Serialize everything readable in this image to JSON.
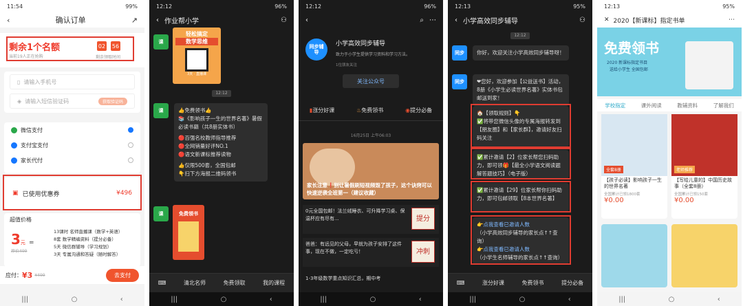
{
  "colors": {
    "accent": "#ef3b2c",
    "orange": "#f0542d",
    "green": "#2aa84a",
    "dark_bg": "#1b1b1b",
    "bubble": "#2e2e2e"
  },
  "p1": {
    "time": "11:54",
    "battery": "99%",
    "title": "确认订单",
    "remaining": "剩余1个名额",
    "remaining_sub": "当前19人正在抢购",
    "cd1": "02",
    "cd2": "56",
    "cd_sub": "剩余领取时间",
    "phone_placeholder": "请输入手机号",
    "code_placeholder": "请输入短信验证码",
    "get_code": "获取验证码",
    "payments": [
      {
        "label": "微信支付",
        "color": "#2aa84a"
      },
      {
        "label": "支付宝支付",
        "color": "#1677ff"
      },
      {
        "label": "家长代付",
        "color": "#1677ff"
      }
    ],
    "coupon_label": "已使用优惠券",
    "coupon_amount": "¥496",
    "value_title": "超值价格",
    "price_big": "3",
    "price_unit": "元",
    "price_eq": "=",
    "price_old": "原价499",
    "items": [
      "13课时 名师直播课（数学+英语）",
      "8套 数学精编资料（提分必备）",
      "5天 微信群辅导（学习规划）",
      "3天 专属沟通和答疑（随时解答）"
    ],
    "pay_label": "应付：",
    "pay_amount": "¥3",
    "pay_old": "¥499",
    "pay_button": "去支付"
  },
  "p2": {
    "time": "12:12",
    "battery": "96%",
    "title": "作业帮小学",
    "poster_title1": "轻松搞定",
    "poster_title2": "数学思维",
    "poster_sub": "3天 · 直播课",
    "timestamp": "12:12",
    "messages": [
      "👍免费领书👍",
      "📚《影响孩子一生的世界名著》暑假必读书籍（共8册实体书）",
      "🔴百强名校教师指导推荐",
      "🔴全网销量好评NO.1",
      "🔴语文新课标推荐读物",
      "👍仅限500套，全国包邮",
      "👇扫下方海报二维码领书"
    ],
    "poster2_title": "免费领书",
    "menu": [
      "清北名师",
      "免费领取",
      "我的课程"
    ],
    "avatar": "课"
  },
  "p3": {
    "time": "12:12",
    "battery": "96%",
    "name": "小学高效同步辅导",
    "logo_text": "同步辅导",
    "desc": "致力于小学生提供学习资料和学习方法。",
    "followers": "1位朋友关注",
    "follow_button": "关注公众号",
    "tabs": [
      "涨分好课",
      "免费领书",
      "提分必备"
    ],
    "date": "16月25日 上午06:03",
    "headline": "家长注意❗别让暑假刷短视频毁了孩子，这个诀窍可以快速逆袭全班第一（建议收藏）",
    "articles": [
      {
        "text": "0元全国包邮！法兰绒睡衣、可升降学习桌、保温杯应有尽有...",
        "tag": "提分"
      },
      {
        "text": "爸爸：有远见的父母，早就为孩子安排了这件事，现在不做，一定吃亏！",
        "tag": "冲刺"
      },
      {
        "text": "1-3年级数学重点知识汇总，期中考",
        "tag": ""
      }
    ]
  },
  "p4": {
    "time": "12:13",
    "battery": "95%",
    "title": "小学高效同步辅导",
    "timestamp": "12:12",
    "m1": "你好，欢迎关注小学高效同步辅导呀！",
    "m2": "❤您好，欢迎参加【公益送书】活动，8册《小学生必读世界名著》实体书包邮送到家！",
    "m3": [
      "🏠【领取规则】👇",
      "✅将带您微信头像的专属海报转发到【朋友圈】和【家长群】，邀请好友扫码关注"
    ],
    "m4": "✅累计邀请【2】位家长帮您扫码助力，即可领🎁【最全小学语文阅读题解答题技巧】（电子版）",
    "m5": "✅累计邀请【29】位家长帮你扫码助力，即可包邮领取【8本世界名著】",
    "m6": [
      "👉点我查看已邀请人数",
      "（小学高效同步辅导的家长点↑↑查询）",
      "👉点我查看已邀请人数",
      "（小学生名师辅导的家长点↑↑查询）"
    ],
    "menu": [
      "涨分好课",
      "免费领书",
      "提分必备"
    ]
  },
  "p5": {
    "time": "12:13",
    "battery": "95%",
    "title": "2020【新课标】指定书单",
    "banner_title": "免费领书",
    "banner_sub": "2020 新课标指定书目",
    "banner_sub2": "送给小学生 全国包邮",
    "tabs": [
      "学校指定",
      "课外阅读",
      "教辅资料",
      "了解我们"
    ],
    "books": [
      {
        "badge": "全套8册",
        "title": "【孩子必读】影响孩子一生的世界名著",
        "meta": "全国累计已领1800套",
        "price": "¥0.00"
      },
      {
        "badge": "老师推荐",
        "title": "【写给儿童的】中国历史故事（全套8册）",
        "meta": "全国累计已领150套",
        "price": "¥0.00"
      }
    ]
  }
}
